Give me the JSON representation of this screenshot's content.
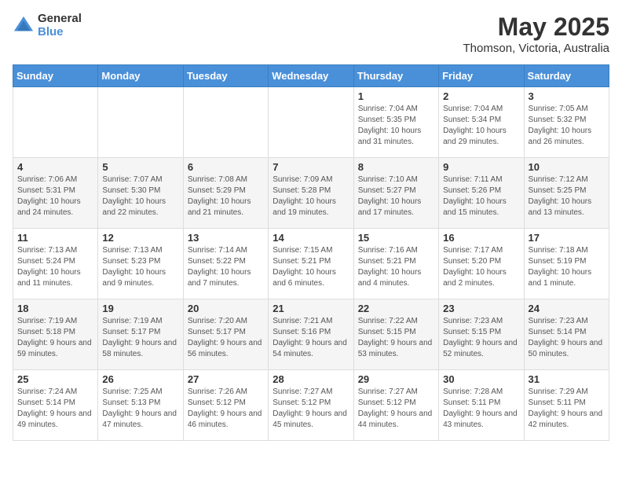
{
  "logo": {
    "general": "General",
    "blue": "Blue"
  },
  "title": "May 2025",
  "subtitle": "Thomson, Victoria, Australia",
  "days_of_week": [
    "Sunday",
    "Monday",
    "Tuesday",
    "Wednesday",
    "Thursday",
    "Friday",
    "Saturday"
  ],
  "weeks": [
    [
      {
        "day": "",
        "sunrise": "",
        "sunset": "",
        "daylight": ""
      },
      {
        "day": "",
        "sunrise": "",
        "sunset": "",
        "daylight": ""
      },
      {
        "day": "",
        "sunrise": "",
        "sunset": "",
        "daylight": ""
      },
      {
        "day": "",
        "sunrise": "",
        "sunset": "",
        "daylight": ""
      },
      {
        "day": "1",
        "sunrise": "Sunrise: 7:04 AM",
        "sunset": "Sunset: 5:35 PM",
        "daylight": "Daylight: 10 hours and 31 minutes."
      },
      {
        "day": "2",
        "sunrise": "Sunrise: 7:04 AM",
        "sunset": "Sunset: 5:34 PM",
        "daylight": "Daylight: 10 hours and 29 minutes."
      },
      {
        "day": "3",
        "sunrise": "Sunrise: 7:05 AM",
        "sunset": "Sunset: 5:32 PM",
        "daylight": "Daylight: 10 hours and 26 minutes."
      }
    ],
    [
      {
        "day": "4",
        "sunrise": "Sunrise: 7:06 AM",
        "sunset": "Sunset: 5:31 PM",
        "daylight": "Daylight: 10 hours and 24 minutes."
      },
      {
        "day": "5",
        "sunrise": "Sunrise: 7:07 AM",
        "sunset": "Sunset: 5:30 PM",
        "daylight": "Daylight: 10 hours and 22 minutes."
      },
      {
        "day": "6",
        "sunrise": "Sunrise: 7:08 AM",
        "sunset": "Sunset: 5:29 PM",
        "daylight": "Daylight: 10 hours and 21 minutes."
      },
      {
        "day": "7",
        "sunrise": "Sunrise: 7:09 AM",
        "sunset": "Sunset: 5:28 PM",
        "daylight": "Daylight: 10 hours and 19 minutes."
      },
      {
        "day": "8",
        "sunrise": "Sunrise: 7:10 AM",
        "sunset": "Sunset: 5:27 PM",
        "daylight": "Daylight: 10 hours and 17 minutes."
      },
      {
        "day": "9",
        "sunrise": "Sunrise: 7:11 AM",
        "sunset": "Sunset: 5:26 PM",
        "daylight": "Daylight: 10 hours and 15 minutes."
      },
      {
        "day": "10",
        "sunrise": "Sunrise: 7:12 AM",
        "sunset": "Sunset: 5:25 PM",
        "daylight": "Daylight: 10 hours and 13 minutes."
      }
    ],
    [
      {
        "day": "11",
        "sunrise": "Sunrise: 7:13 AM",
        "sunset": "Sunset: 5:24 PM",
        "daylight": "Daylight: 10 hours and 11 minutes."
      },
      {
        "day": "12",
        "sunrise": "Sunrise: 7:13 AM",
        "sunset": "Sunset: 5:23 PM",
        "daylight": "Daylight: 10 hours and 9 minutes."
      },
      {
        "day": "13",
        "sunrise": "Sunrise: 7:14 AM",
        "sunset": "Sunset: 5:22 PM",
        "daylight": "Daylight: 10 hours and 7 minutes."
      },
      {
        "day": "14",
        "sunrise": "Sunrise: 7:15 AM",
        "sunset": "Sunset: 5:21 PM",
        "daylight": "Daylight: 10 hours and 6 minutes."
      },
      {
        "day": "15",
        "sunrise": "Sunrise: 7:16 AM",
        "sunset": "Sunset: 5:21 PM",
        "daylight": "Daylight: 10 hours and 4 minutes."
      },
      {
        "day": "16",
        "sunrise": "Sunrise: 7:17 AM",
        "sunset": "Sunset: 5:20 PM",
        "daylight": "Daylight: 10 hours and 2 minutes."
      },
      {
        "day": "17",
        "sunrise": "Sunrise: 7:18 AM",
        "sunset": "Sunset: 5:19 PM",
        "daylight": "Daylight: 10 hours and 1 minute."
      }
    ],
    [
      {
        "day": "18",
        "sunrise": "Sunrise: 7:19 AM",
        "sunset": "Sunset: 5:18 PM",
        "daylight": "Daylight: 9 hours and 59 minutes."
      },
      {
        "day": "19",
        "sunrise": "Sunrise: 7:19 AM",
        "sunset": "Sunset: 5:17 PM",
        "daylight": "Daylight: 9 hours and 58 minutes."
      },
      {
        "day": "20",
        "sunrise": "Sunrise: 7:20 AM",
        "sunset": "Sunset: 5:17 PM",
        "daylight": "Daylight: 9 hours and 56 minutes."
      },
      {
        "day": "21",
        "sunrise": "Sunrise: 7:21 AM",
        "sunset": "Sunset: 5:16 PM",
        "daylight": "Daylight: 9 hours and 54 minutes."
      },
      {
        "day": "22",
        "sunrise": "Sunrise: 7:22 AM",
        "sunset": "Sunset: 5:15 PM",
        "daylight": "Daylight: 9 hours and 53 minutes."
      },
      {
        "day": "23",
        "sunrise": "Sunrise: 7:23 AM",
        "sunset": "Sunset: 5:15 PM",
        "daylight": "Daylight: 9 hours and 52 minutes."
      },
      {
        "day": "24",
        "sunrise": "Sunrise: 7:23 AM",
        "sunset": "Sunset: 5:14 PM",
        "daylight": "Daylight: 9 hours and 50 minutes."
      }
    ],
    [
      {
        "day": "25",
        "sunrise": "Sunrise: 7:24 AM",
        "sunset": "Sunset: 5:14 PM",
        "daylight": "Daylight: 9 hours and 49 minutes."
      },
      {
        "day": "26",
        "sunrise": "Sunrise: 7:25 AM",
        "sunset": "Sunset: 5:13 PM",
        "daylight": "Daylight: 9 hours and 47 minutes."
      },
      {
        "day": "27",
        "sunrise": "Sunrise: 7:26 AM",
        "sunset": "Sunset: 5:12 PM",
        "daylight": "Daylight: 9 hours and 46 minutes."
      },
      {
        "day": "28",
        "sunrise": "Sunrise: 7:27 AM",
        "sunset": "Sunset: 5:12 PM",
        "daylight": "Daylight: 9 hours and 45 minutes."
      },
      {
        "day": "29",
        "sunrise": "Sunrise: 7:27 AM",
        "sunset": "Sunset: 5:12 PM",
        "daylight": "Daylight: 9 hours and 44 minutes."
      },
      {
        "day": "30",
        "sunrise": "Sunrise: 7:28 AM",
        "sunset": "Sunset: 5:11 PM",
        "daylight": "Daylight: 9 hours and 43 minutes."
      },
      {
        "day": "31",
        "sunrise": "Sunrise: 7:29 AM",
        "sunset": "Sunset: 5:11 PM",
        "daylight": "Daylight: 9 hours and 42 minutes."
      }
    ]
  ]
}
